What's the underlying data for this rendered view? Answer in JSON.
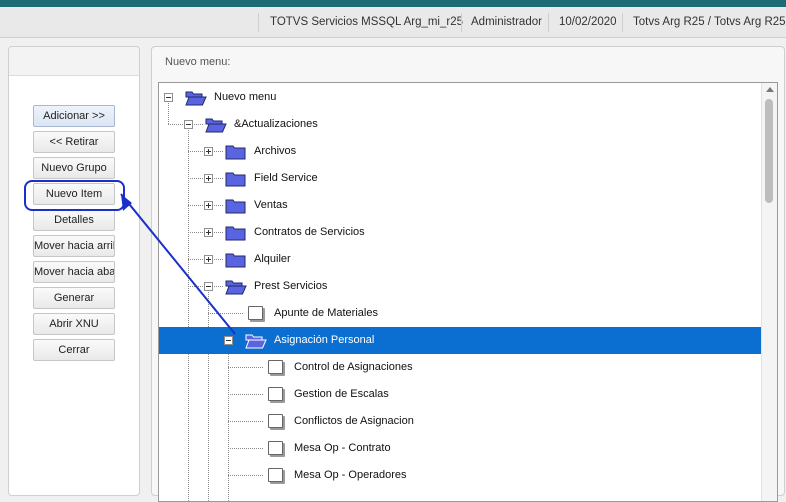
{
  "statusbar": {
    "server": "TOTVS Servicios MSSQL Arg_mi_r25",
    "user": "Administrador",
    "date": "10/02/2020",
    "environment": "Totvs Arg R25 / Totvs Arg R25"
  },
  "sidebar": {
    "buttons": [
      {
        "id": "add",
        "label": "Adicionar >>"
      },
      {
        "id": "remove",
        "label": "<< Retirar"
      },
      {
        "id": "new-group",
        "label": "Nuevo Grupo"
      },
      {
        "id": "new-item",
        "label": "Nuevo Item"
      },
      {
        "id": "details",
        "label": "Detalles"
      },
      {
        "id": "move-up",
        "label": "Mover hacia arriba"
      },
      {
        "id": "move-down",
        "label": "Mover hacia abajo"
      },
      {
        "id": "generate",
        "label": "Generar"
      },
      {
        "id": "open-xnu",
        "label": "Abrir XNU"
      },
      {
        "id": "close",
        "label": "Cerrar"
      }
    ]
  },
  "main": {
    "label": "Nuevo menu:",
    "tree": [
      {
        "label": "Nuevo menu",
        "level": 0,
        "type": "folder-open",
        "expander": "minus"
      },
      {
        "label": "&Actualizaciones",
        "level": 1,
        "type": "folder-open",
        "expander": "minus"
      },
      {
        "label": "Archivos",
        "level": 2,
        "type": "folder",
        "expander": "plus"
      },
      {
        "label": "Field Service",
        "level": 2,
        "type": "folder",
        "expander": "plus"
      },
      {
        "label": "Ventas",
        "level": 2,
        "type": "folder",
        "expander": "plus"
      },
      {
        "label": "Contratos de Servicios",
        "level": 2,
        "type": "folder",
        "expander": "plus"
      },
      {
        "label": "Alquiler",
        "level": 2,
        "type": "folder",
        "expander": "plus"
      },
      {
        "label": "Prest Servicios",
        "level": 2,
        "type": "folder-open",
        "expander": "minus"
      },
      {
        "label": "Apunte de Materiales",
        "level": 3,
        "type": "doc",
        "expander": "none"
      },
      {
        "label": "Asignación Personal",
        "level": 3,
        "type": "folder-open",
        "expander": "minus",
        "selected": true
      },
      {
        "label": "Control de Asignaciones",
        "level": 4,
        "type": "doc",
        "expander": "none"
      },
      {
        "label": "Gestion de Escalas",
        "level": 4,
        "type": "doc",
        "expander": "none"
      },
      {
        "label": "Conflictos de Asignacion",
        "level": 4,
        "type": "doc",
        "expander": "none"
      },
      {
        "label": "Mesa Op - Contrato",
        "level": 4,
        "type": "doc",
        "expander": "none"
      },
      {
        "label": "Mesa Op - Operadores",
        "level": 4,
        "type": "doc",
        "expander": "none"
      }
    ]
  },
  "colors": {
    "topbar": "#1f6b74",
    "selection": "#0a6fd0",
    "annotation": "#1b2fc9",
    "folder": "#5b64e0"
  }
}
